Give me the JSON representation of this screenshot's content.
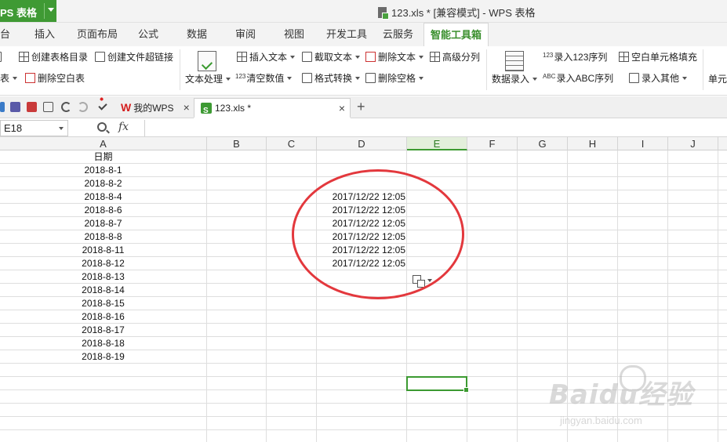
{
  "app": {
    "name": "PS 表格"
  },
  "window": {
    "title": "123.xls * [兼容模式] - WPS 表格"
  },
  "ribbon_tabs": [
    "台",
    "插入",
    "页面布局",
    "公式",
    "数据",
    "审阅",
    "视图",
    "开发工具",
    "云服务",
    "智能工具箱"
  ],
  "ribbon": {
    "left_row1": "创建表格目录",
    "left_row1b": "创建文件超链接",
    "left_row2_prefix": "表",
    "left_row2": "删除空白表",
    "text_process": "文本处理",
    "insert_text": "插入文本",
    "extract_text": "截取文本",
    "delete_text": "删除文本",
    "advanced_split": "高级分列",
    "clear_values_num": "123",
    "clear_values": "清空数值",
    "format_convert": "格式转换",
    "delete_spaces": "删除空格",
    "data_entry": "数据录入",
    "enter_123_num": "123",
    "enter_123": "录入123序列",
    "fill_blank": "空白单元格填充",
    "enter_abc_num": "ABC",
    "enter_abc": "录入ABC序列",
    "enter_other": "录入其他",
    "cell_partial": "单元"
  },
  "doc_tabs": [
    {
      "label": "我的WPS"
    },
    {
      "label": "123.xls *"
    }
  ],
  "formula_bar": {
    "name_box": "E18",
    "fx": "fx",
    "value": ""
  },
  "columns": [
    "A",
    "B",
    "C",
    "D",
    "E",
    "F",
    "G",
    "H",
    "I",
    "J"
  ],
  "selected_column": "E",
  "column_a": [
    "日期",
    "2018-8-1",
    "2018-8-2",
    "2018-8-4",
    "2018-8-6",
    "2018-8-7",
    "2018-8-8",
    "2018-8-11",
    "2018-8-12",
    "2018-8-13",
    "2018-8-14",
    "2018-8-15",
    "2018-8-16",
    "2018-8-17",
    "2018-8-18",
    "2018-8-19"
  ],
  "column_d": [
    "2017/12/22 12:05",
    "2017/12/22 12:05",
    "2017/12/22 12:05",
    "2017/12/22 12:05",
    "2017/12/22 12:05",
    "2017/12/22 12:05"
  ],
  "colors": {
    "accent": "#3c9a31",
    "annotation": "#e3383d"
  },
  "watermark": {
    "main": "Baidu经验",
    "sub": "jingyan.baidu.com"
  }
}
